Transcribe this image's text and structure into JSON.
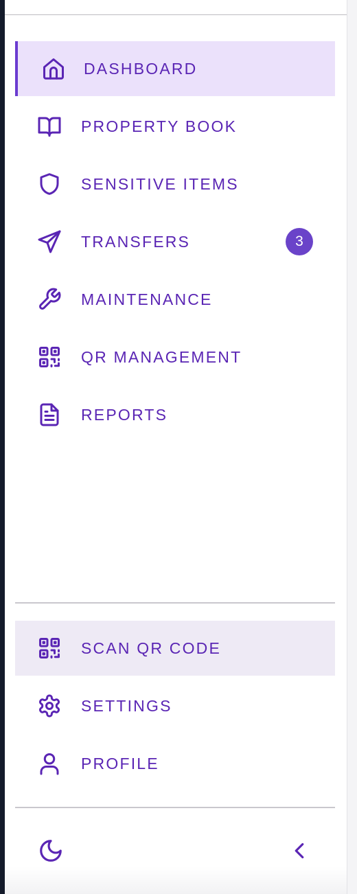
{
  "nav": {
    "items": [
      {
        "label": "DASHBOARD",
        "icon": "home-icon",
        "active": true
      },
      {
        "label": "PROPERTY BOOK",
        "icon": "book-icon"
      },
      {
        "label": "SENSITIVE ITEMS",
        "icon": "shield-icon"
      },
      {
        "label": "TRANSFERS",
        "icon": "send-icon",
        "badge": "3"
      },
      {
        "label": "MAINTENANCE",
        "icon": "wrench-icon"
      },
      {
        "label": "QR MANAGEMENT",
        "icon": "qr-code-icon"
      },
      {
        "label": "REPORTS",
        "icon": "document-icon"
      }
    ]
  },
  "secondary": {
    "items": [
      {
        "label": "SCAN QR CODE",
        "icon": "qr-code-icon",
        "highlighted": true
      },
      {
        "label": "SETTINGS",
        "icon": "gear-icon"
      },
      {
        "label": "PROFILE",
        "icon": "user-icon"
      }
    ]
  },
  "footer": {
    "theme_toggle_icon": "moon-icon",
    "collapse_icon": "chevron-left-icon"
  },
  "colors": {
    "accent": "#5a25b4",
    "active_bg": "#ebe1fb",
    "badge_bg": "#6a43c9",
    "highlight_bg": "#eeeaf5"
  }
}
